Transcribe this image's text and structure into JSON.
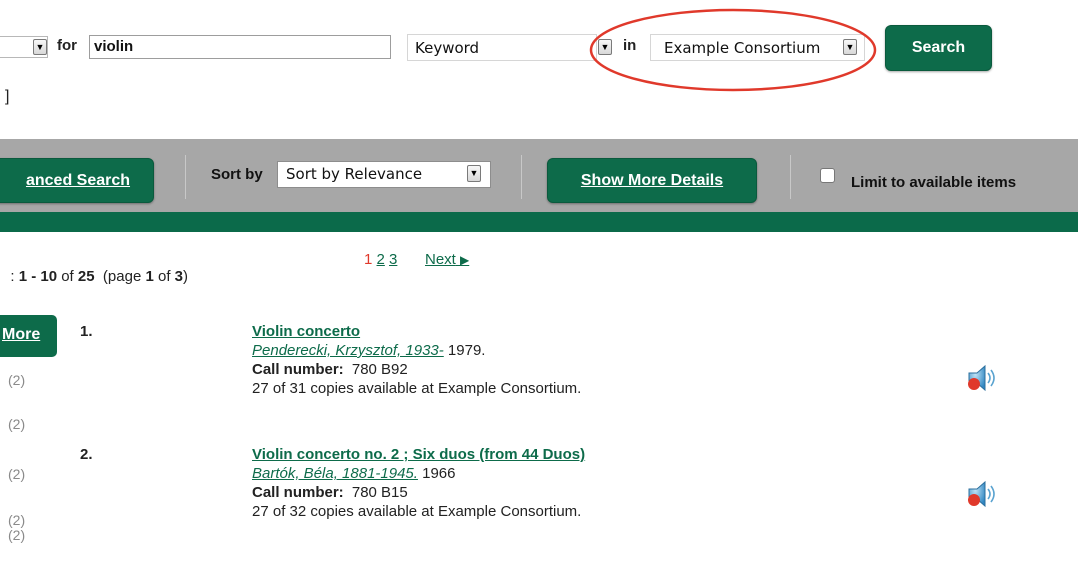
{
  "search": {
    "for_label": "for",
    "query_value": "violin",
    "field_select": "Keyword",
    "in_label": "in",
    "scope_select": "Example Consortium",
    "search_button": "Search",
    "bracket": "]"
  },
  "toolbar": {
    "advanced_search": "anced Search",
    "sort_label": "Sort by",
    "sort_select": "Sort by Relevance",
    "show_more_details": "Show More Details",
    "limit_label": "Limit to available items"
  },
  "pagination": {
    "prefix": ": ",
    "range": "1 - 10",
    "of_text": " of ",
    "total": "25",
    "page_open": "  (page ",
    "page_current": "1",
    "page_of": " of ",
    "page_total": "3",
    "page_close": ")",
    "pages": [
      "1",
      "2",
      "3"
    ],
    "next": "Next"
  },
  "sidebar": {
    "more_label": "More",
    "counts": [
      "(2)",
      "(2)",
      "(2)",
      "(2)",
      "(2)"
    ]
  },
  "results": [
    {
      "number": "1.",
      "title": "Violin concerto",
      "author": "Penderecki, Krzysztof, 1933-",
      "year": " 1979.",
      "call_label": "Call number:",
      "call_value": "780 B92",
      "availability": "27 of 31 copies available at Example Consortium.",
      "icon": "audio-recording-icon"
    },
    {
      "number": "2.",
      "title": "Violin concerto no. 2 ; Six duos (from 44 Duos)",
      "author": "Bartók, Béla, 1881-1945.",
      "year": " 1966",
      "call_label": "Call number:",
      "call_value": "780 B15",
      "availability": "27 of 32 copies available at Example Consortium.",
      "icon": "audio-recording-icon"
    }
  ],
  "colors": {
    "brand_green": "#0d6b4a",
    "toolbar_gray": "#a7a7a7",
    "annotation_red": "#e0392b",
    "current_page_red": "#e0392b"
  }
}
